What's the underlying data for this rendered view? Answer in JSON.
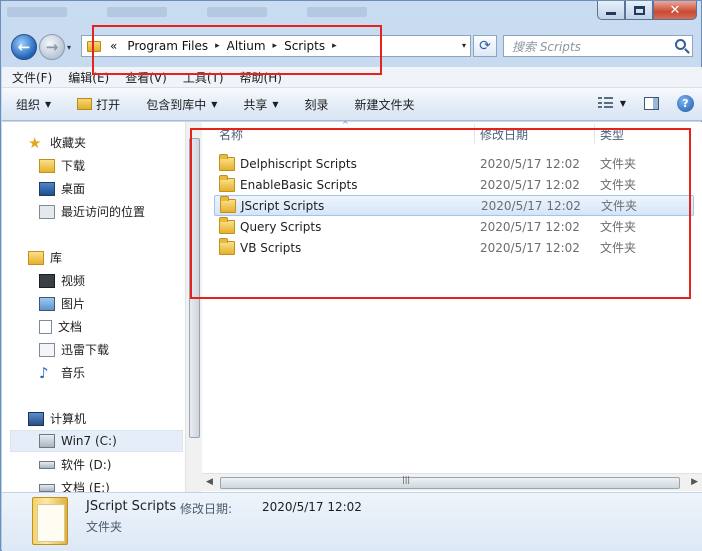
{
  "window": {
    "controls": {
      "minimize": "–",
      "maximize": "□",
      "close": "✕"
    }
  },
  "nav": {
    "back_icon": "back-arrow-icon",
    "forward_icon": "forward-arrow-icon",
    "history_dropdown": "▾",
    "address": {
      "overflow": "«",
      "crumbs": [
        "Program Files",
        "Altium",
        "Scripts"
      ],
      "separator": "▸"
    },
    "refresh_icon": "refresh-icon",
    "search_placeholder": "搜索 Scripts"
  },
  "menubar": {
    "items": [
      "文件(F)",
      "编辑(E)",
      "查看(V)",
      "工具(T)",
      "帮助(H)"
    ]
  },
  "toolbar": {
    "organize": "组织",
    "open": "打开",
    "include_library": "包含到库中",
    "share": "共享",
    "burn": "刻录",
    "new_folder": "新建文件夹"
  },
  "sidebar": {
    "favorites": {
      "label": "收藏夹",
      "items": [
        "下载",
        "桌面",
        "最近访问的位置"
      ]
    },
    "libraries": {
      "label": "库",
      "items": [
        "视频",
        "图片",
        "文档",
        "迅雷下载",
        "音乐"
      ]
    },
    "computer": {
      "label": "计算机",
      "items": [
        "Win7 (C:)",
        "软件 (D:)",
        "文档 (E:)"
      ]
    }
  },
  "columns": {
    "name": "名称",
    "date": "修改日期",
    "type": "类型"
  },
  "files": [
    {
      "name": "Delphiscript Scripts",
      "date": "2020/5/17 12:02",
      "type": "文件夹"
    },
    {
      "name": "EnableBasic Scripts",
      "date": "2020/5/17 12:02",
      "type": "文件夹"
    },
    {
      "name": "JScript Scripts",
      "date": "2020/5/17 12:02",
      "type": "文件夹"
    },
    {
      "name": "Query Scripts",
      "date": "2020/5/17 12:02",
      "type": "文件夹"
    },
    {
      "name": "VB Scripts",
      "date": "2020/5/17 12:02",
      "type": "文件夹"
    }
  ],
  "selected_index": 2,
  "details": {
    "name": "JScript Scripts",
    "date_label": "修改日期:",
    "date": "2020/5/17 12:02",
    "type": "文件夹"
  },
  "colors": {
    "annotation": "#e6221f",
    "selection": "#d4e5f9"
  }
}
